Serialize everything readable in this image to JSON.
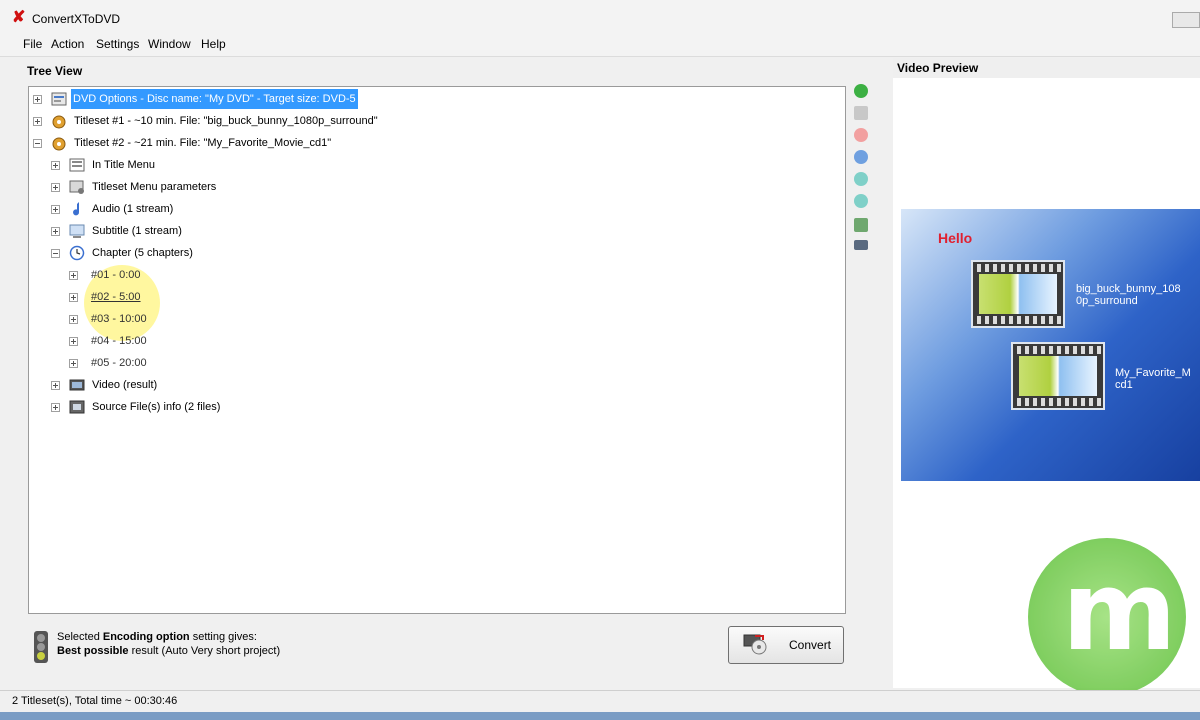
{
  "window": {
    "title": "ConvertXToDVD"
  },
  "menu": [
    "File",
    "Action",
    "Settings",
    "Window",
    "Help"
  ],
  "tree_view": {
    "label": "Tree View",
    "rows": [
      {
        "text": "DVD Options - Disc name: \"My DVD\" - Target size: DVD-5",
        "selected": true
      },
      {
        "text": "Titleset #1 - ~10 min. File: \"big_buck_bunny_1080p_surround\""
      },
      {
        "text": "Titleset #2 - ~21 min. File: \"My_Favorite_Movie_cd1\""
      },
      {
        "text": "In Title Menu"
      },
      {
        "text": "Titleset Menu parameters"
      },
      {
        "text": "Audio (1 stream)"
      },
      {
        "text": "Subtitle (1 stream)"
      },
      {
        "text": "Chapter (5 chapters)"
      },
      {
        "text": "#01 - 0:00"
      },
      {
        "text": "#02 - 5:00"
      },
      {
        "text": "#03 - 10:00"
      },
      {
        "text": "#04 - 15:00"
      },
      {
        "text": "#05 - 20:00"
      },
      {
        "text": "Video (result)"
      },
      {
        "text": "Source File(s) info (2 files)"
      }
    ]
  },
  "preview": {
    "label": "Video Preview",
    "menu_title": "Hello",
    "items": [
      "big_buck_bunny_108\n0p_surround",
      "My_Favorite_M\ncd1"
    ]
  },
  "encoding": {
    "line1_prefix": "Selected ",
    "line1_bold": "Encoding option",
    "line1_suffix": " setting gives:",
    "line2_bold": "Best possible",
    "line2_suffix": " result (Auto Very short project)"
  },
  "convert_button": "Convert",
  "status": "2 Titleset(s), Total time ~ 00:30:46",
  "colors": {
    "selection": "#3399ff",
    "preview_blue": "#2e63c8",
    "hello_red": "#e02030"
  }
}
